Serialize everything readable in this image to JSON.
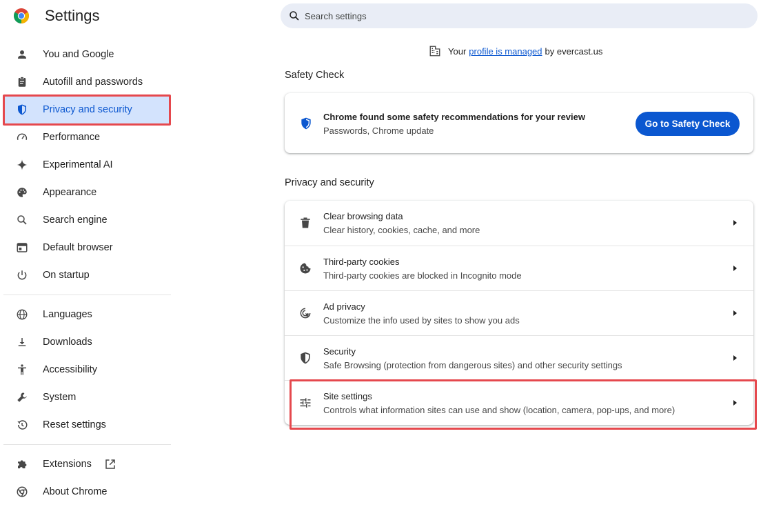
{
  "app": {
    "title": "Settings",
    "logo_icon": "chrome-logo-icon"
  },
  "search": {
    "placeholder": "Search settings",
    "value": ""
  },
  "sidebar": {
    "items": [
      {
        "label": "You and Google",
        "icon": "person-icon"
      },
      {
        "label": "Autofill and passwords",
        "icon": "clipboard-icon"
      },
      {
        "label": "Privacy and security",
        "icon": "shield-icon",
        "active": true
      },
      {
        "label": "Performance",
        "icon": "speedometer-icon"
      },
      {
        "label": "Experimental AI",
        "icon": "sparkle-icon"
      },
      {
        "label": "Appearance",
        "icon": "palette-icon"
      },
      {
        "label": "Search engine",
        "icon": "search-icon"
      },
      {
        "label": "Default browser",
        "icon": "browser-window-icon"
      },
      {
        "label": "On startup",
        "icon": "power-icon"
      },
      {
        "label": "Languages",
        "icon": "globe-icon"
      },
      {
        "label": "Downloads",
        "icon": "download-icon"
      },
      {
        "label": "Accessibility",
        "icon": "accessibility-icon"
      },
      {
        "label": "System",
        "icon": "wrench-icon"
      },
      {
        "label": "Reset settings",
        "icon": "history-icon"
      },
      {
        "label": "Extensions",
        "icon": "puzzle-icon",
        "trailing_icon": "open-in-new-icon"
      },
      {
        "label": "About Chrome",
        "icon": "chrome-icon"
      }
    ]
  },
  "managed": {
    "prefix": "Your",
    "link": "profile is managed",
    "suffix": "by evercast.us"
  },
  "safety_check": {
    "section_title": "Safety Check",
    "title": "Chrome found some safety recommendations for your review",
    "subtitle": "Passwords, Chrome update",
    "button": "Go to Safety Check"
  },
  "privacy": {
    "section_title": "Privacy and security",
    "rows": [
      {
        "title": "Clear browsing data",
        "subtitle": "Clear history, cookies, cache, and more",
        "icon": "trash-icon"
      },
      {
        "title": "Third-party cookies",
        "subtitle": "Third-party cookies are blocked in Incognito mode",
        "icon": "cookie-icon"
      },
      {
        "title": "Ad privacy",
        "subtitle": "Customize the info used by sites to show you ads",
        "icon": "ad-privacy-icon"
      },
      {
        "title": "Security",
        "subtitle": "Safe Browsing (protection from dangerous sites) and other security settings",
        "icon": "security-shield-icon"
      },
      {
        "title": "Site settings",
        "subtitle": "Controls what information sites can use and show (location, camera, pop-ups, and more)",
        "icon": "tune-sliders-icon"
      }
    ]
  },
  "colors": {
    "accent": "#0b57d0",
    "active_bg": "#d3e3fd",
    "highlight": "#e5484d",
    "search_bg": "#e9edf6"
  }
}
